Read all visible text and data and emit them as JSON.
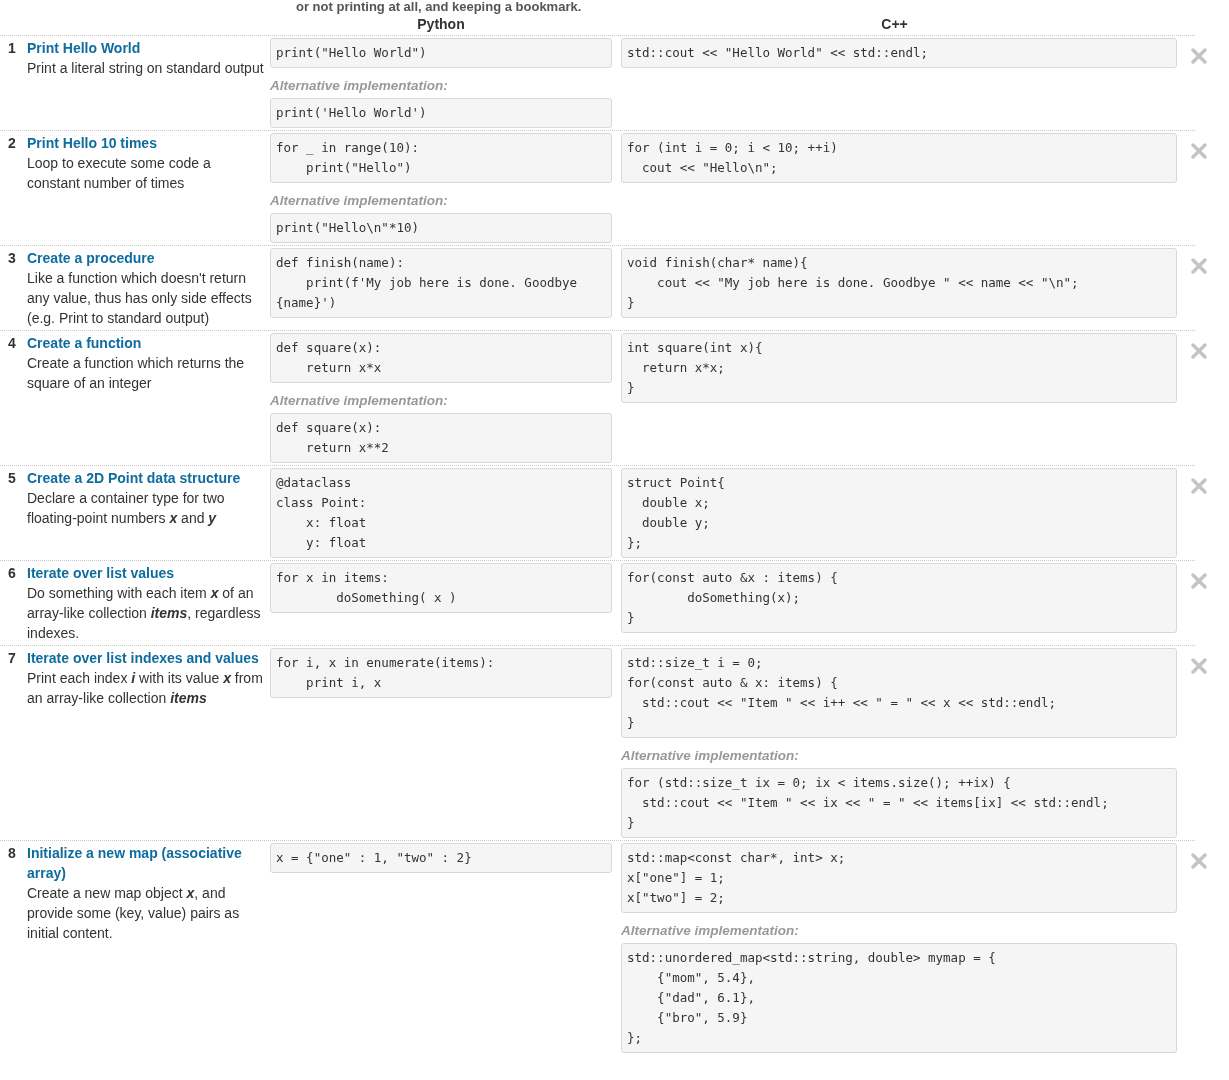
{
  "banner": "or not printing at all, and keeping a bookmark.",
  "columns": [
    "Python",
    "C++"
  ],
  "rows": [
    {
      "number": "1",
      "title": "Print Hello World",
      "description": "Print a literal string on standard output",
      "python": [
        {
          "code": "print(\"Hello World\")"
        },
        {
          "label": "Alternative implementation:",
          "code": "print('Hello World')"
        }
      ],
      "cpp": [
        {
          "code": "std::cout << \"Hello World\" << std::endl;"
        }
      ]
    },
    {
      "number": "2",
      "title": "Print Hello 10 times",
      "description": "Loop to execute some code a constant number of times",
      "python": [
        {
          "code": "for _ in range(10):\n    print(\"Hello\")"
        },
        {
          "label": "Alternative implementation:",
          "code": "print(\"Hello\\n\"*10)"
        }
      ],
      "cpp": [
        {
          "code": "for (int i = 0; i < 10; ++i)\n  cout << \"Hello\\n\";"
        }
      ]
    },
    {
      "number": "3",
      "title": "Create a procedure",
      "description": "Like a function which doesn't return any value, thus has only side effects (e.g. Print to standard output)",
      "python": [
        {
          "code": "def finish(name):\n    print(f'My job here is done. Goodbye {name}')"
        }
      ],
      "cpp": [
        {
          "code": "void finish(char* name){\n    cout << \"My job here is done. Goodbye \" << name << \"\\n\";\n}"
        }
      ]
    },
    {
      "number": "4",
      "title": "Create a function",
      "description": "Create a function which returns the square of an integer",
      "python": [
        {
          "code": "def square(x):\n    return x*x"
        },
        {
          "label": "Alternative implementation:",
          "code": "def square(x):\n    return x**2"
        }
      ],
      "cpp": [
        {
          "code": "int square(int x){\n  return x*x;\n}"
        }
      ]
    },
    {
      "number": "5",
      "title": "Create a 2D Point data structure",
      "description": "Declare a container type for two floating-point numbers **x** and **y**",
      "python": [
        {
          "code": "@dataclass\nclass Point:\n    x: float\n    y: float"
        }
      ],
      "cpp": [
        {
          "code": "struct Point{\n  double x;\n  double y;\n};"
        }
      ]
    },
    {
      "number": "6",
      "title": "Iterate over list values",
      "description": "Do something with each item **x** of an array-like collection **items**, regardless indexes.",
      "python": [
        {
          "code": "for x in items:\n        doSomething( x )"
        }
      ],
      "cpp": [
        {
          "code": "for(const auto &x : items) {\n        doSomething(x);\n}"
        }
      ]
    },
    {
      "number": "7",
      "title": "Iterate over list indexes and values",
      "description": "Print each index **i** with its value **x** from an array-like collection **items**",
      "python": [
        {
          "code": "for i, x in enumerate(items):\n    print i, x"
        }
      ],
      "cpp": [
        {
          "code": "std::size_t i = 0;\nfor(const auto & x: items) {\n  std::cout << \"Item \" << i++ << \" = \" << x << std::endl;\n}"
        },
        {
          "label": "Alternative implementation:",
          "code": "for (std::size_t ix = 0; ix < items.size(); ++ix) {\n  std::cout << \"Item \" << ix << \" = \" << items[ix] << std::endl;\n}"
        }
      ]
    },
    {
      "number": "8",
      "title": "Initialize a new map (associative array)",
      "description": "Create a new map object **x**, and provide some (key, value) pairs as initial content.",
      "python": [
        {
          "code": "x = {\"one\" : 1, \"two\" : 2}"
        }
      ],
      "cpp": [
        {
          "code": "std::map<const char*, int> x;\nx[\"one\"] = 1;\nx[\"two\"] = 2;"
        },
        {
          "label": "Alternative implementation:",
          "code": "std::unordered_map<std::string, double> mymap = {\n    {\"mom\", 5.4},\n    {\"dad\", 6.1},\n    {\"bro\", 5.9}\n};"
        }
      ]
    }
  ]
}
